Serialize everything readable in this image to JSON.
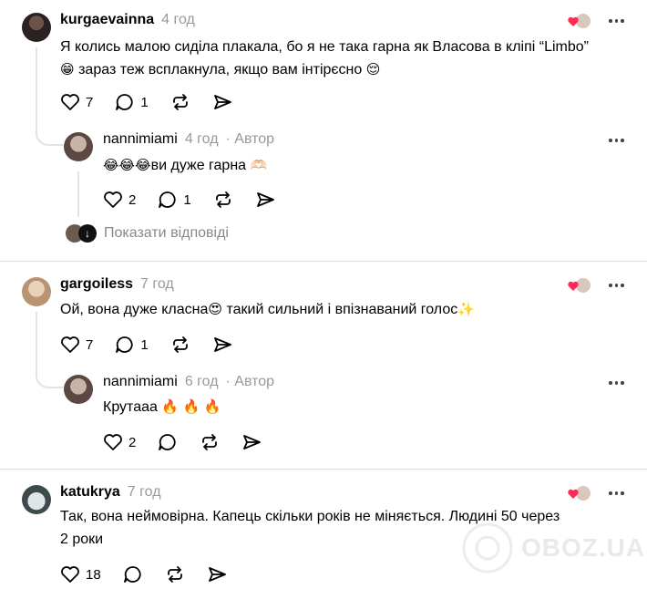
{
  "comments": [
    {
      "username": "kurgaevainna",
      "time": "4 год",
      "text_line1": "Я колись малою сиділа плакала, бо я не така гарна як Власова в кліпі “Limbo”",
      "text_line2": " зараз теж всплакнула, якщо вам інтірєсно ",
      "likes": "7",
      "replies": "1",
      "reply": {
        "username": "nannimiami",
        "time": "4 год",
        "author_label": "· Автор",
        "text": "ви дуже гарна ",
        "likes": "2",
        "replies": "1"
      },
      "show_replies": "Показати відповіді"
    },
    {
      "username": "gargoiless",
      "time": "7 год",
      "text_a": "Ой, вона дуже класна",
      "text_b": " такий сильний і впізнаваний голос",
      "likes": "7",
      "replies": "1",
      "reply": {
        "username": "nannimiami",
        "time": "6 год",
        "author_label": "· Автор",
        "text": "Крутааа ",
        "likes": "2"
      }
    },
    {
      "username": "katukrya",
      "time": "7 год",
      "text_line1": "Так, вона неймовірна. Капець скільки років не міняється. Людині 50 через",
      "text_line2": "2 роки",
      "likes": "18"
    }
  ],
  "watermark": "OBOZ.UA",
  "colors": {
    "heart_red": "#ff2a55",
    "muted": "#999999",
    "divider": "#dcdcdc"
  },
  "icons": [
    "heart-icon",
    "comment-icon",
    "repost-icon",
    "share-icon",
    "more-icon",
    "liked-heart-icon"
  ]
}
